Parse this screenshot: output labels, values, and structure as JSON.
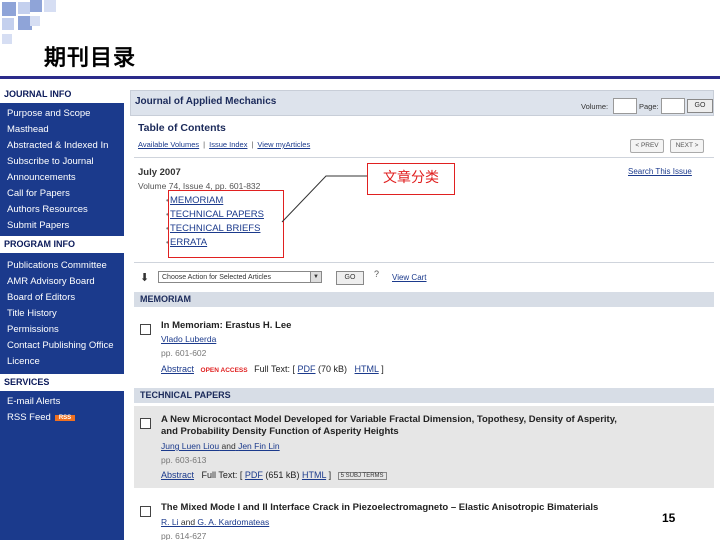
{
  "slide": {
    "title": "期刊目录",
    "annotation": "文章分类",
    "page_number": "15"
  },
  "sidebar": {
    "journal_info": {
      "heading": "JOURNAL INFO",
      "items": [
        "Purpose and Scope",
        "Masthead",
        "Abstracted & Indexed In",
        "Subscribe to Journal",
        "Announcements",
        "Call for Papers",
        "Authors Resources",
        "Submit Papers"
      ]
    },
    "program_info": {
      "heading": "PROGRAM INFO",
      "items": [
        "Publications Committee",
        "AMR Advisory Board",
        "Board of Editors",
        "Title History",
        "Permissions",
        "Contact Publishing Office",
        "Licence"
      ]
    },
    "services": {
      "heading": "SERVICES",
      "items": [
        "E-mail Alerts",
        "RSS Feed"
      ],
      "rss_badge": "RSS"
    }
  },
  "topbar": {
    "journal_title": "Journal of Applied Mechanics",
    "volume_label": "Volume:",
    "page_label": "Page:",
    "go_label": "GO"
  },
  "toc": {
    "title": "Table of Contents",
    "tools": [
      "Available Volumes",
      "Issue Index",
      "View myArticles"
    ],
    "prev_label": "< PREV",
    "next_label": "NEXT >",
    "issue_date": "July 2007",
    "issue_meta": "Volume 74, Issue 4, pp. 601-832",
    "search_issue": "Search This Issue",
    "sections": [
      "MEMORIAM",
      "TECHNICAL PAPERS",
      "TECHNICAL BRIEFS",
      "ERRATA"
    ]
  },
  "actions": {
    "select_label": "Choose Action for Selected Articles",
    "go_label": "GO",
    "help": "?",
    "view_cart": "View Cart"
  },
  "memoriam": {
    "header": "MEMORIAM",
    "title": "In Memoriam: Erastus H. Lee",
    "author": "Vlado Luberda",
    "pages": "pp. 601-602",
    "abstract": "Abstract",
    "open_access": "OPEN ACCESS",
    "full_text": "Full Text:",
    "pdf": "PDF",
    "pdf_size": "(70 kB)",
    "html": "HTML"
  },
  "technical": {
    "header": "TECHNICAL PAPERS",
    "articles": [
      {
        "title1": "A New Microcontact Model Developed for Variable Fractal Dimension, Topothesy, Density of Asperity,",
        "title2": "and Probability Density Function of Asperity Heights",
        "author1": "Jung Luen Liou",
        "and": "and",
        "author2": "Jen Fin Lin",
        "pages": "pp. 603-613",
        "abstract": "Abstract",
        "full_text": "Full Text:",
        "pdf": "PDF",
        "pdf_size": "(651 kB)",
        "html": "HTML",
        "badge": "5 SUBJ TERMS"
      },
      {
        "title1": "The Mixed Mode I and II Interface Crack in Piezoelectromagneto – Elastic Anisotropic Bimaterials",
        "author1": "R. Li",
        "and": "and",
        "author2": "G. A. Kardomateas",
        "pages": "pp. 614-627"
      }
    ]
  }
}
